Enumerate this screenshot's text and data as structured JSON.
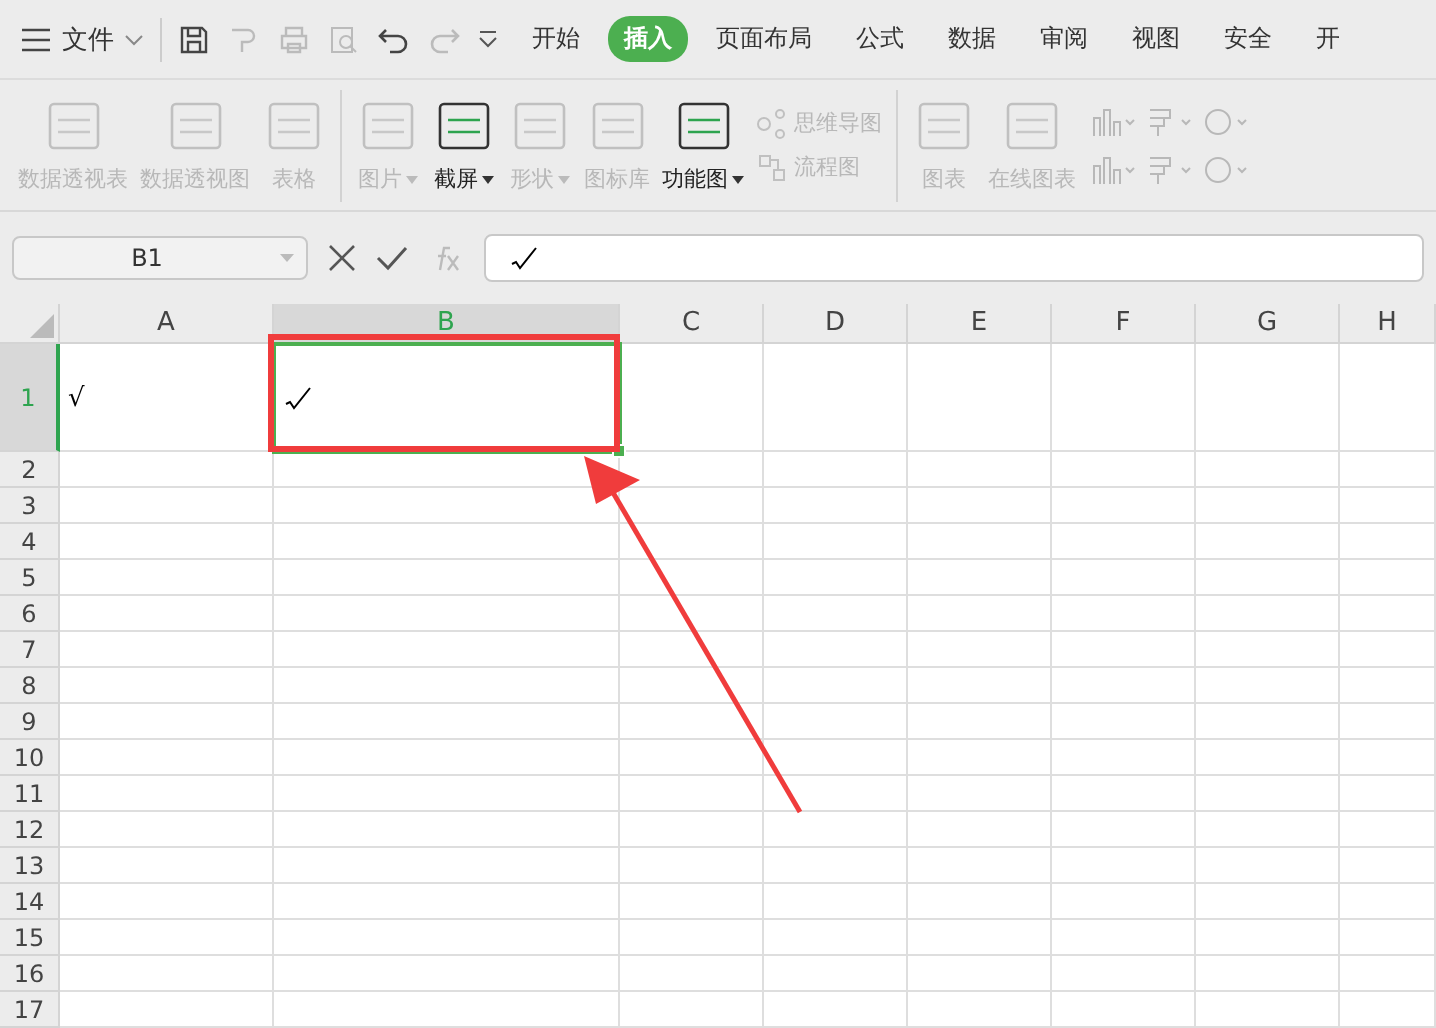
{
  "menu": {
    "label": "文件"
  },
  "tabs": [
    {
      "label": "开始",
      "selected": false
    },
    {
      "label": "插入",
      "selected": true
    },
    {
      "label": "页面布局",
      "selected": false
    },
    {
      "label": "公式",
      "selected": false
    },
    {
      "label": "数据",
      "selected": false
    },
    {
      "label": "审阅",
      "selected": false
    },
    {
      "label": "视图",
      "selected": false
    },
    {
      "label": "安全",
      "selected": false
    },
    {
      "label": "开",
      "selected": false
    }
  ],
  "ribbon": [
    {
      "kind": "large",
      "label": "数据透视表",
      "disabled": true,
      "dropdown": false
    },
    {
      "kind": "large",
      "label": "数据透视图",
      "disabled": true,
      "dropdown": false
    },
    {
      "kind": "large",
      "label": "表格",
      "disabled": true,
      "dropdown": false
    },
    {
      "kind": "separator"
    },
    {
      "kind": "large",
      "label": "图片",
      "disabled": true,
      "dropdown": true
    },
    {
      "kind": "large",
      "label": "截屏",
      "disabled": false,
      "dropdown": true
    },
    {
      "kind": "large",
      "label": "形状",
      "disabled": true,
      "dropdown": true
    },
    {
      "kind": "large",
      "label": "图标库",
      "disabled": true,
      "dropdown": false
    },
    {
      "kind": "large",
      "label": "功能图",
      "disabled": false,
      "dropdown": true
    },
    {
      "kind": "small",
      "label": "思维导图",
      "label2": "流程图",
      "disabled": true
    },
    {
      "kind": "separator"
    },
    {
      "kind": "large",
      "label": "图表",
      "disabled": true,
      "dropdown": false
    },
    {
      "kind": "large",
      "label": "在线图表",
      "disabled": true,
      "dropdown": false
    },
    {
      "kind": "charts",
      "disabled": true
    }
  ],
  "name_box": {
    "value": "B1"
  },
  "columns": [
    {
      "label": "A",
      "selected": false
    },
    {
      "label": "B",
      "selected": true
    },
    {
      "label": "C",
      "selected": false
    },
    {
      "label": "D",
      "selected": false
    },
    {
      "label": "E",
      "selected": false
    },
    {
      "label": "F",
      "selected": false
    },
    {
      "label": "G",
      "selected": false
    },
    {
      "label": "H",
      "selected": false
    }
  ],
  "rows": [
    {
      "label": "1",
      "selected": true,
      "cells": [
        {
          "text": "√"
        }
      ]
    },
    {
      "label": "2",
      "selected": false
    },
    {
      "label": "3",
      "selected": false
    },
    {
      "label": "4",
      "selected": false
    },
    {
      "label": "5",
      "selected": false
    },
    {
      "label": "6",
      "selected": false
    },
    {
      "label": "7",
      "selected": false
    },
    {
      "label": "8",
      "selected": false
    },
    {
      "label": "9",
      "selected": false
    },
    {
      "label": "10",
      "selected": false
    },
    {
      "label": "11",
      "selected": false
    },
    {
      "label": "12",
      "selected": false
    },
    {
      "label": "13",
      "selected": false
    },
    {
      "label": "14",
      "selected": false
    },
    {
      "label": "15",
      "selected": false
    },
    {
      "label": "16",
      "selected": false
    },
    {
      "label": "17",
      "selected": false
    }
  ]
}
